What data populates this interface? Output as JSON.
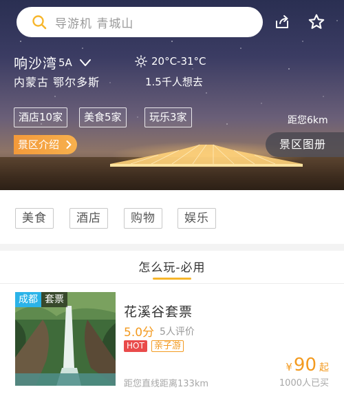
{
  "search": {
    "placeholder": "导游机 青城山",
    "icon": "search-icon"
  },
  "header": {
    "share_icon": "share-icon",
    "favorite_icon": "star-icon"
  },
  "scenic": {
    "name": "响沙湾",
    "rank": "5A",
    "region": "内蒙古 鄂尔多斯",
    "temperature": "20°C-31°C",
    "want_to_go": "1.5千人想去",
    "distance": "距您6km"
  },
  "facilities": [
    "酒店10家",
    "美食5家",
    "玩乐3家"
  ],
  "actions": {
    "intro": "景区介绍",
    "album": "景区图册"
  },
  "categories": [
    "美食",
    "酒店",
    "购物",
    "娱乐"
  ],
  "section": {
    "title": "怎么玩-必用"
  },
  "listing": {
    "city_tag": "成都",
    "type_tag": "套票",
    "name": "花溪谷套票",
    "score": "5.0分",
    "reviews": "5人评价",
    "hot_tag": "HOT",
    "family_tag": "亲子游",
    "currency": "¥",
    "price": "90",
    "price_suffix": "起",
    "distance": "距您直线距离133km",
    "bought": "1000人已买"
  },
  "colors": {
    "accent": "#f39a1f",
    "underline": "#f7b62b",
    "city_tag": "#2bb3e8",
    "hot": "#e94b4b"
  }
}
